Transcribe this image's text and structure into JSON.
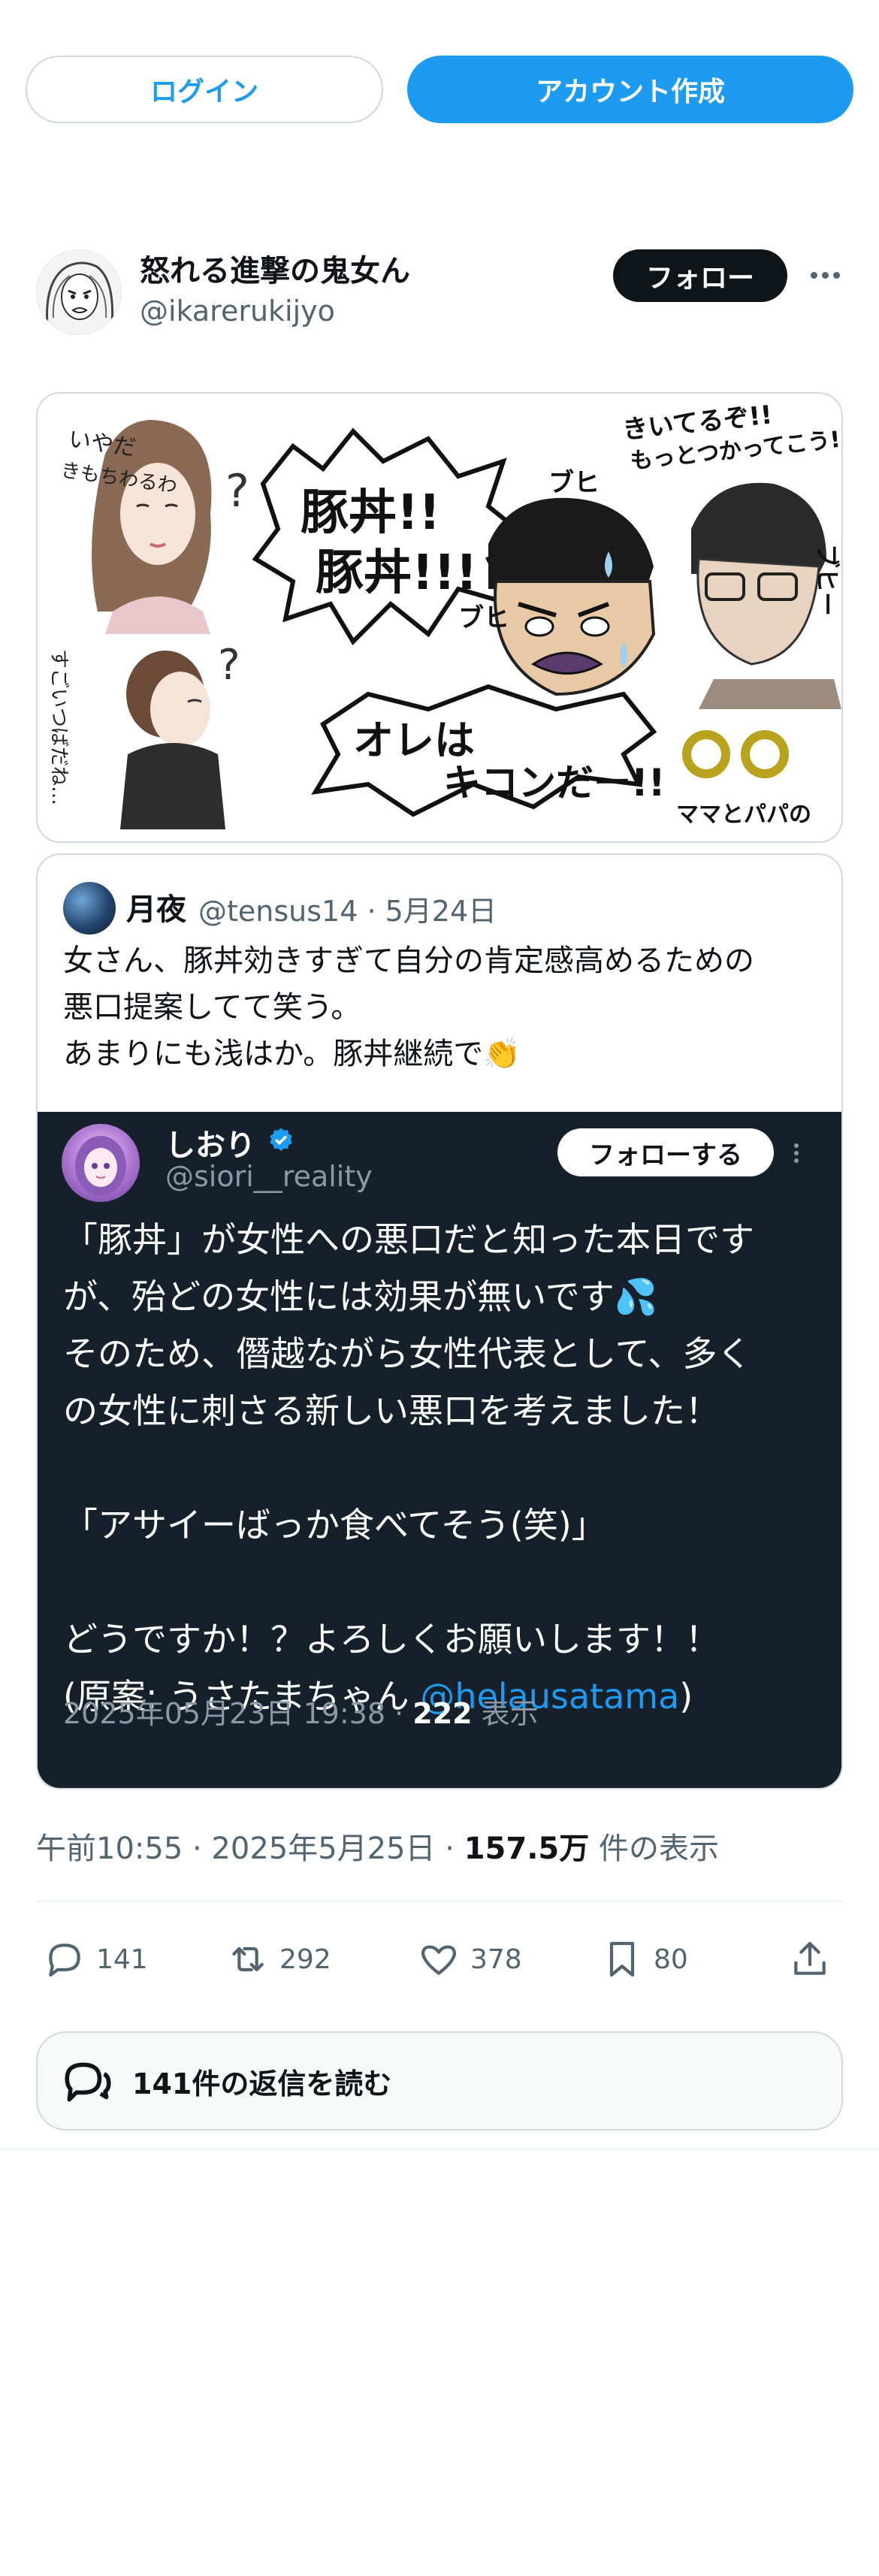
{
  "top_buttons": {
    "login": "ログイン",
    "create_account": "アカウント作成"
  },
  "author": {
    "name": "怒れる進撃の鬼女ん",
    "handle": "@ikarerukijyo",
    "follow": "フォロー"
  },
  "main_image": {
    "bubble_1": "豚丼!!\n豚丼!!!",
    "bubble_2": "オレは\nキコンだー!!",
    "woman_1_text": "いやだ\nきもちわるわ",
    "woman_2_text": "すごいつばだね…",
    "man_text": "きいてるぞ!!\nもっとつかってこう!!",
    "sfx_1": "ブヒ",
    "sfx_2": "ブヒ",
    "sfx_3": "ブヒー",
    "caption": "ママとパパの"
  },
  "quote": {
    "name": "月夜",
    "meta": "@tensus14 · 5月24日",
    "text": "女さん、豚丼効きすぎて自分の肯定感高めるための\n悪口提案してて笑う。\nあまりにも浅はか。豚丼継続で👏",
    "inner": {
      "name": "しおり",
      "handle": "@siori__reality",
      "follow": "フォローする",
      "text_main": "「豚丼」が女性への悪口だと知った本日です\nが、殆どの女性には効果が無いです💦\nそのため、僭越ながら女性代表として、多く\nの女性に刺さる新しい悪口を考えました！\n\n「アサイーばっか食べてそう(笑)」\n\nどうですか！？よろしくお願いします！！\n(原案: うさたまちゃん ",
      "mention": "@helausatama",
      "text_end": ")",
      "footer_date": "2025年05月23日 19:38 · ",
      "footer_views": "222",
      "footer_views_label": " 表示"
    }
  },
  "meta": {
    "time": "午前10:55 · 2025年5月25日 · ",
    "views": "157.5万",
    "views_label": " 件の表示"
  },
  "actions": {
    "replies": "141",
    "reposts": "292",
    "likes": "378",
    "bookmarks": "80"
  },
  "read_replies": "141件の返信を読む",
  "colors": {
    "accent": "#1d9bf0",
    "dark_panel": "#15202b",
    "text": "#0f1419",
    "muted": "#536471"
  }
}
